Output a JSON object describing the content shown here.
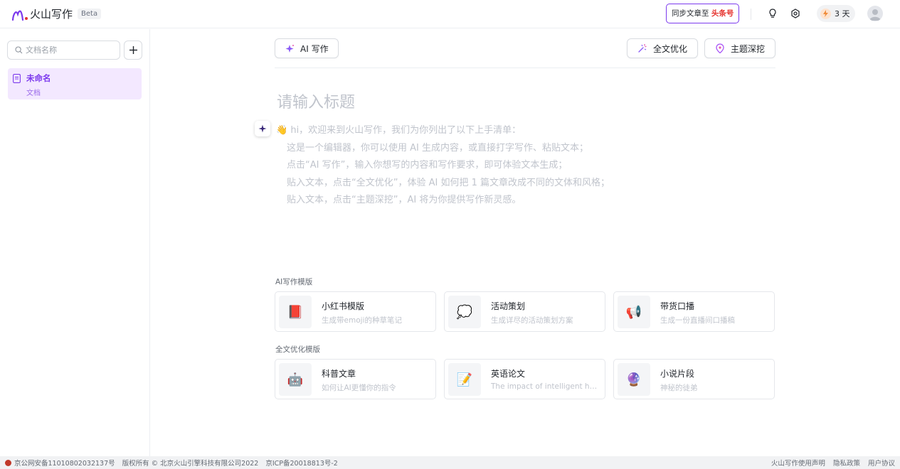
{
  "header": {
    "app_name": "火山写作",
    "beta": "Beta",
    "sync_prefix": "同步文章至",
    "sync_target": "头条号",
    "streak": "3 天"
  },
  "sidebar": {
    "search_placeholder": "文档名称",
    "docs": [
      {
        "title": "未命名",
        "subtitle": "文档"
      }
    ]
  },
  "toolbar": {
    "ai_write": "AI 写作",
    "optimize": "全文优化",
    "deep_dive": "主题深挖"
  },
  "editor": {
    "title_placeholder": "请输入标题",
    "intro_lines": [
      "hi，欢迎来到火山写作，我们为你列出了以下上手清单：",
      "这是一个编辑器，你可以使用 AI 生成内容，或直接打字写作、粘贴文本；",
      "点击“AI 写作”，输入你想写的内容和写作要求，即可体验文本生成；",
      "贴入文本，点击“全文优化”，体验 AI 如何把 1 篇文章改成不同的文体和风格；",
      "贴入文本，点击“主题深挖”，AI 将为你提供写作新灵感。"
    ]
  },
  "templates": {
    "ai_label": "AI写作模版",
    "ai_cards": [
      {
        "title": "小红书模版",
        "subtitle": "生成带emoji的种草笔记",
        "icon": "📕"
      },
      {
        "title": "活动策划",
        "subtitle": "生成详尽的活动策划方案",
        "icon": "💭"
      },
      {
        "title": "带货口播",
        "subtitle": "生成一份直播间口播稿",
        "icon": "📢"
      }
    ],
    "opt_label": "全文优化模版",
    "opt_cards": [
      {
        "title": "科普文章",
        "subtitle": "如何让AI更懂你的指令",
        "icon": "🤖"
      },
      {
        "title": "英语论文",
        "subtitle": "The impact of intelligent hou...",
        "icon": "📝"
      },
      {
        "title": "小说片段",
        "subtitle": "神秘的徒弟",
        "icon": "🔮"
      }
    ]
  },
  "footer": {
    "police": "京公网安备11010802032137号",
    "copyright": "版权所有 © 北京火山引擎科技有限公司2022",
    "icp": "京ICP备20018813号-2",
    "statement": "火山写作使用声明",
    "privacy": "隐私政策",
    "agreement": "用户协议"
  },
  "colors": {
    "accent": "#7c3aed",
    "accent_bg": "#f3e8ff",
    "sync_red": "#e5322d"
  }
}
